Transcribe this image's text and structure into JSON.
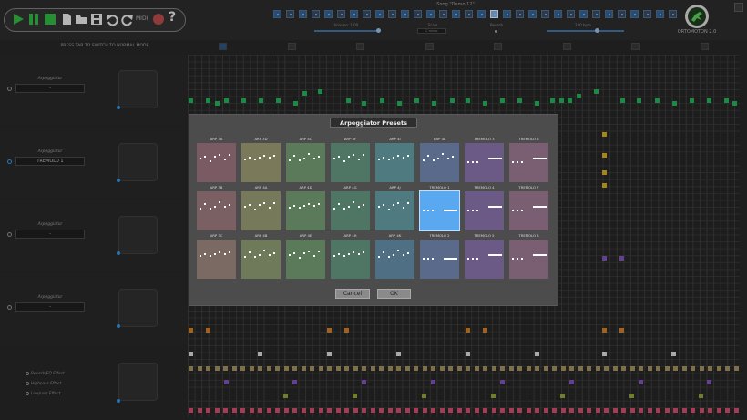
{
  "header": {
    "song_title": "Song \"Demo 12\"",
    "volume_label": "Volume: 1.00",
    "scale_label": "Scale",
    "scale_value": "C minor",
    "reverb_label": "Reverb",
    "bpm_label": "120 bpm",
    "brand": "ORTOMOTON 2.0",
    "midi_label": "MIDI",
    "help_label": "?",
    "steps_total": 32,
    "selected_step": 17
  },
  "hint": "PRESS TAB TO SWITCH TO NORMAL MODE",
  "tracks": [
    {
      "arp_label": "Arpeggiator",
      "arp_value": "-"
    },
    {
      "arp_label": "Arpeggiator",
      "arp_value": "TREMOLO 1"
    },
    {
      "arp_label": "Arpeggiator",
      "arp_value": "-"
    },
    {
      "arp_label": "Arpeggiator",
      "arp_value": "-"
    }
  ],
  "effects": [
    "Reverb/EQ Effect",
    "Highpass Effect",
    "Lowpass Effect"
  ],
  "dialog": {
    "title": "Arpeggiator Presets",
    "cancel_label": "Cancel",
    "ok_label": "OK",
    "selected": "TREMOLO 1",
    "presets": [
      {
        "name": "ARP 3A",
        "color": "#7a5a63",
        "kind": "arp"
      },
      {
        "name": "ARP 3D",
        "color": "#7a7a5a",
        "kind": "arp"
      },
      {
        "name": "ARP 4C",
        "color": "#5a7a5a",
        "kind": "arp"
      },
      {
        "name": "ARP 4F",
        "color": "#4f7564",
        "kind": "arp"
      },
      {
        "name": "ARP 4I",
        "color": "#4f7a80",
        "kind": "arp"
      },
      {
        "name": "ARP 4L",
        "color": "#5a6a8a",
        "kind": "arp"
      },
      {
        "name": "TREMOLO 3",
        "color": "#6a5a85",
        "kind": "trem"
      },
      {
        "name": "TREMOLO 6",
        "color": "#7a5f72",
        "kind": "trem"
      },
      {
        "name": "ARP 3B",
        "color": "#7a5f63",
        "kind": "arp"
      },
      {
        "name": "ARP 4A",
        "color": "#767a5a",
        "kind": "arp"
      },
      {
        "name": "ARP 4D",
        "color": "#5a7a5a",
        "kind": "arp"
      },
      {
        "name": "ARP 4G",
        "color": "#4f7564",
        "kind": "arp"
      },
      {
        "name": "ARP 4J",
        "color": "#4f7a80",
        "kind": "arp"
      },
      {
        "name": "TREMOLO 1",
        "color": "#5aa8f0",
        "kind": "trem"
      },
      {
        "name": "TREMOLO 4",
        "color": "#6a5a85",
        "kind": "trem"
      },
      {
        "name": "TREMOLO 7",
        "color": "#7a5f72",
        "kind": "trem"
      },
      {
        "name": "ARP 3C",
        "color": "#7a6a63",
        "kind": "arp"
      },
      {
        "name": "ARP 4B",
        "color": "#6f7a5a",
        "kind": "arp"
      },
      {
        "name": "ARP 4E",
        "color": "#5a7a5a",
        "kind": "arp"
      },
      {
        "name": "ARP 4H",
        "color": "#4f7564",
        "kind": "arp"
      },
      {
        "name": "ARP 4K",
        "color": "#4f6f84",
        "kind": "arp"
      },
      {
        "name": "TREMOLO 2",
        "color": "#5a6a8a",
        "kind": "trem"
      },
      {
        "name": "TREMOLO 5",
        "color": "#6a5a85",
        "kind": "trem"
      },
      {
        "name": "TREMOLO 8",
        "color": "#7a5f72",
        "kind": "trem"
      }
    ]
  },
  "colors": {
    "melody": "#1faa55",
    "bass": "#c8a520",
    "perc": "#c8781e",
    "purple": "#7a4fb0",
    "white": "#d0d0d0",
    "tan": "#9a8a5a",
    "olive": "#8a9a3a",
    "pink": "#c84a6a",
    "accent": "#2f8fdf"
  }
}
